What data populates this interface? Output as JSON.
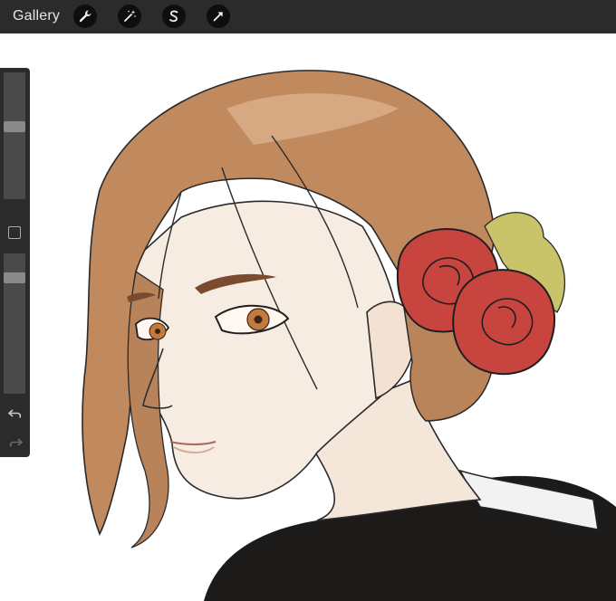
{
  "toolbar": {
    "gallery_label": "Gallery",
    "tools": [
      "wrench-icon",
      "magic-wand-icon",
      "selection-s-icon",
      "transform-arrow-icon"
    ]
  },
  "sidebar": {
    "brush_size_level": 0.58,
    "opacity_level": 0.85,
    "undo_icon": "undo-icon",
    "redo_icon": "redo-icon"
  },
  "colors": {
    "toolbar_bg": "#2b2b2b",
    "hair": "#c08a5e",
    "rose": "#c8443e",
    "skin": "#f7ece2",
    "jacket": "#1d1b19"
  }
}
